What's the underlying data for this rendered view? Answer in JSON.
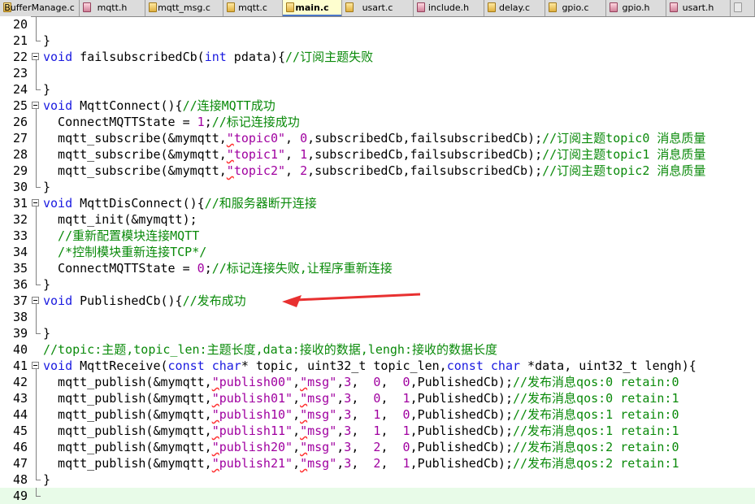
{
  "tabs": [
    {
      "label": "BufferManage.c",
      "type": "c",
      "active": false
    },
    {
      "label": "mqtt.h",
      "type": "h",
      "active": false
    },
    {
      "label": "mqtt_msg.c",
      "type": "c",
      "active": false
    },
    {
      "label": "mqtt.c",
      "type": "c",
      "active": false
    },
    {
      "label": "main.c",
      "type": "c",
      "active": true
    },
    {
      "label": "usart.c",
      "type": "c",
      "active": false
    },
    {
      "label": "include.h",
      "type": "h",
      "active": false
    },
    {
      "label": "delay.c",
      "type": "c",
      "active": false
    },
    {
      "label": "gpio.c",
      "type": "c",
      "active": false
    },
    {
      "label": "gpio.h",
      "type": "h",
      "active": false
    },
    {
      "label": "usart.h",
      "type": "h",
      "active": false
    },
    {
      "label": "",
      "type": "d",
      "active": false
    }
  ],
  "editor": {
    "current_line": 49,
    "annotation_color": "#e83030",
    "lines": [
      {
        "n": 20,
        "fold": "line",
        "tokens": []
      },
      {
        "n": 21,
        "fold": "end",
        "tokens": [
          [
            "p",
            "}"
          ]
        ]
      },
      {
        "n": 22,
        "fold": "box",
        "tokens": [
          [
            "kw",
            "void"
          ],
          [
            "p",
            " failsubscribedCb("
          ],
          [
            "kw",
            "int"
          ],
          [
            "p",
            " pdata){"
          ],
          [
            "cm",
            "//订阅主题失败"
          ]
        ]
      },
      {
        "n": 23,
        "fold": "line",
        "tokens": []
      },
      {
        "n": 24,
        "fold": "end",
        "tokens": [
          [
            "p",
            "}"
          ]
        ]
      },
      {
        "n": 25,
        "fold": "box",
        "tokens": [
          [
            "kw",
            "void"
          ],
          [
            "p",
            " MqttConnect(){"
          ],
          [
            "cm",
            "//连接MQTT成功"
          ]
        ]
      },
      {
        "n": 26,
        "fold": "line",
        "tokens": [
          [
            "p",
            "  ConnectMQTTState = "
          ],
          [
            "num",
            "1"
          ],
          [
            "p",
            ";"
          ],
          [
            "cm",
            "//标记连接成功"
          ]
        ]
      },
      {
        "n": 27,
        "fold": "line",
        "tokens": [
          [
            "p",
            "  mqtt_subscribe(&mymqtt,"
          ],
          [
            "str",
            "\"topic0\""
          ],
          [
            "p",
            ", "
          ],
          [
            "num",
            "0"
          ],
          [
            "p",
            ",subscribedCb,failsubscribedCb);"
          ],
          [
            "cm",
            "//订阅主题topic0 消息质量"
          ]
        ]
      },
      {
        "n": 28,
        "fold": "line",
        "tokens": [
          [
            "p",
            "  mqtt_subscribe(&mymqtt,"
          ],
          [
            "str",
            "\"topic1\""
          ],
          [
            "p",
            ", "
          ],
          [
            "num",
            "1"
          ],
          [
            "p",
            ",subscribedCb,failsubscribedCb);"
          ],
          [
            "cm",
            "//订阅主题topic1 消息质量"
          ]
        ]
      },
      {
        "n": 29,
        "fold": "line",
        "tokens": [
          [
            "p",
            "  mqtt_subscribe(&mymqtt,"
          ],
          [
            "str",
            "\"topic2\""
          ],
          [
            "p",
            ", "
          ],
          [
            "num",
            "2"
          ],
          [
            "p",
            ",subscribedCb,failsubscribedCb);"
          ],
          [
            "cm",
            "//订阅主题topic2 消息质量"
          ]
        ]
      },
      {
        "n": 30,
        "fold": "end",
        "tokens": [
          [
            "p",
            "}"
          ]
        ]
      },
      {
        "n": 31,
        "fold": "box",
        "tokens": [
          [
            "kw",
            "void"
          ],
          [
            "p",
            " MqttDisConnect(){"
          ],
          [
            "cm",
            "//和服务器断开连接"
          ]
        ]
      },
      {
        "n": 32,
        "fold": "line",
        "tokens": [
          [
            "p",
            "  mqtt_init(&mymqtt);"
          ]
        ]
      },
      {
        "n": 33,
        "fold": "line",
        "tokens": [
          [
            "cm",
            "  //重新配置模块连接MQTT"
          ]
        ]
      },
      {
        "n": 34,
        "fold": "line",
        "tokens": [
          [
            "cm",
            "  /*控制模块重新连接TCP*/"
          ]
        ]
      },
      {
        "n": 35,
        "fold": "line",
        "tokens": [
          [
            "p",
            "  ConnectMQTTState = "
          ],
          [
            "num",
            "0"
          ],
          [
            "p",
            ";"
          ],
          [
            "cm",
            "//标记连接失败,让程序重新连接"
          ]
        ]
      },
      {
        "n": 36,
        "fold": "end",
        "tokens": [
          [
            "p",
            "}"
          ]
        ]
      },
      {
        "n": 37,
        "fold": "box",
        "tokens": [
          [
            "kw",
            "void"
          ],
          [
            "p",
            " PublishedCb(){"
          ],
          [
            "cm",
            "//发布成功"
          ]
        ]
      },
      {
        "n": 38,
        "fold": "line",
        "tokens": []
      },
      {
        "n": 39,
        "fold": "end",
        "tokens": [
          [
            "p",
            "}"
          ]
        ]
      },
      {
        "n": 40,
        "fold": "none",
        "tokens": [
          [
            "cm",
            "//topic:主题,topic_len:主题长度,data:接收的数据,lengh:接收的数据长度"
          ]
        ]
      },
      {
        "n": 41,
        "fold": "box",
        "tokens": [
          [
            "kw",
            "void"
          ],
          [
            "p",
            " MqttReceive("
          ],
          [
            "kw",
            "const"
          ],
          [
            "p",
            " "
          ],
          [
            "kw",
            "char"
          ],
          [
            "p",
            "* topic, uint32_t topic_len,"
          ],
          [
            "kw",
            "const"
          ],
          [
            "p",
            " "
          ],
          [
            "kw",
            "char"
          ],
          [
            "p",
            " *data, uint32_t lengh){"
          ]
        ]
      },
      {
        "n": 42,
        "fold": "line",
        "tokens": [
          [
            "p",
            "  mqtt_publish(&mymqtt,"
          ],
          [
            "str",
            "\"publish00\""
          ],
          [
            "p",
            ","
          ],
          [
            "str",
            "\"msg\""
          ],
          [
            "p",
            ","
          ],
          [
            "num",
            "3"
          ],
          [
            "p",
            ",  "
          ],
          [
            "num",
            "0"
          ],
          [
            "p",
            ",  "
          ],
          [
            "num",
            "0"
          ],
          [
            "p",
            ",PublishedCb);"
          ],
          [
            "cm",
            "//发布消息qos:0 retain:0"
          ]
        ]
      },
      {
        "n": 43,
        "fold": "line",
        "tokens": [
          [
            "p",
            "  mqtt_publish(&mymqtt,"
          ],
          [
            "str",
            "\"publish01\""
          ],
          [
            "p",
            ","
          ],
          [
            "str",
            "\"msg\""
          ],
          [
            "p",
            ","
          ],
          [
            "num",
            "3"
          ],
          [
            "p",
            ",  "
          ],
          [
            "num",
            "0"
          ],
          [
            "p",
            ",  "
          ],
          [
            "num",
            "1"
          ],
          [
            "p",
            ",PublishedCb);"
          ],
          [
            "cm",
            "//发布消息qos:0 retain:1"
          ]
        ]
      },
      {
        "n": 44,
        "fold": "line",
        "tokens": [
          [
            "p",
            "  mqtt_publish(&mymqtt,"
          ],
          [
            "str",
            "\"publish10\""
          ],
          [
            "p",
            ","
          ],
          [
            "str",
            "\"msg\""
          ],
          [
            "p",
            ","
          ],
          [
            "num",
            "3"
          ],
          [
            "p",
            ",  "
          ],
          [
            "num",
            "1"
          ],
          [
            "p",
            ",  "
          ],
          [
            "num",
            "0"
          ],
          [
            "p",
            ",PublishedCb);"
          ],
          [
            "cm",
            "//发布消息qos:1 retain:0"
          ]
        ]
      },
      {
        "n": 45,
        "fold": "line",
        "tokens": [
          [
            "p",
            "  mqtt_publish(&mymqtt,"
          ],
          [
            "str",
            "\"publish11\""
          ],
          [
            "p",
            ","
          ],
          [
            "str",
            "\"msg\""
          ],
          [
            "p",
            ","
          ],
          [
            "num",
            "3"
          ],
          [
            "p",
            ",  "
          ],
          [
            "num",
            "1"
          ],
          [
            "p",
            ",  "
          ],
          [
            "num",
            "1"
          ],
          [
            "p",
            ",PublishedCb);"
          ],
          [
            "cm",
            "//发布消息qos:1 retain:1"
          ]
        ]
      },
      {
        "n": 46,
        "fold": "line",
        "tokens": [
          [
            "p",
            "  mqtt_publish(&mymqtt,"
          ],
          [
            "str",
            "\"publish20\""
          ],
          [
            "p",
            ","
          ],
          [
            "str",
            "\"msg\""
          ],
          [
            "p",
            ","
          ],
          [
            "num",
            "3"
          ],
          [
            "p",
            ",  "
          ],
          [
            "num",
            "2"
          ],
          [
            "p",
            ",  "
          ],
          [
            "num",
            "0"
          ],
          [
            "p",
            ",PublishedCb);"
          ],
          [
            "cm",
            "//发布消息qos:2 retain:0"
          ]
        ]
      },
      {
        "n": 47,
        "fold": "line",
        "tokens": [
          [
            "p",
            "  mqtt_publish(&mymqtt,"
          ],
          [
            "str",
            "\"publish21\""
          ],
          [
            "p",
            ","
          ],
          [
            "str",
            "\"msg\""
          ],
          [
            "p",
            ","
          ],
          [
            "num",
            "3"
          ],
          [
            "p",
            ",  "
          ],
          [
            "num",
            "2"
          ],
          [
            "p",
            ",  "
          ],
          [
            "num",
            "1"
          ],
          [
            "p",
            ",PublishedCb);"
          ],
          [
            "cm",
            "//发布消息qos:2 retain:1"
          ]
        ]
      },
      {
        "n": 48,
        "fold": "end",
        "tokens": [
          [
            "p",
            "}"
          ]
        ]
      },
      {
        "n": 49,
        "fold": "end",
        "tokens": []
      }
    ]
  }
}
